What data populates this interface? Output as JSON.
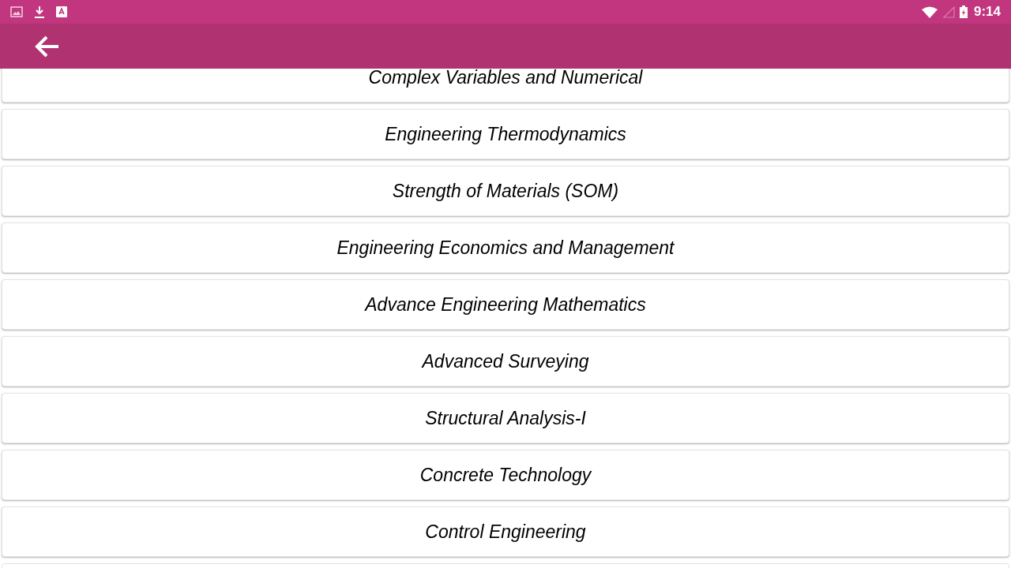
{
  "status_bar": {
    "time": "9:14"
  },
  "toolbar": {
    "back": true
  },
  "subjects": [
    {
      "title": "Complex Variables and Numerical"
    },
    {
      "title": "Engineering Thermodynamics"
    },
    {
      "title": "Strength of Materials (SOM)"
    },
    {
      "title": "Engineering Economics and Management"
    },
    {
      "title": "Advance Engineering Mathematics"
    },
    {
      "title": "Advanced Surveying"
    },
    {
      "title": "Structural Analysis-I"
    },
    {
      "title": "Concrete Technology"
    },
    {
      "title": "Control Engineering"
    }
  ]
}
